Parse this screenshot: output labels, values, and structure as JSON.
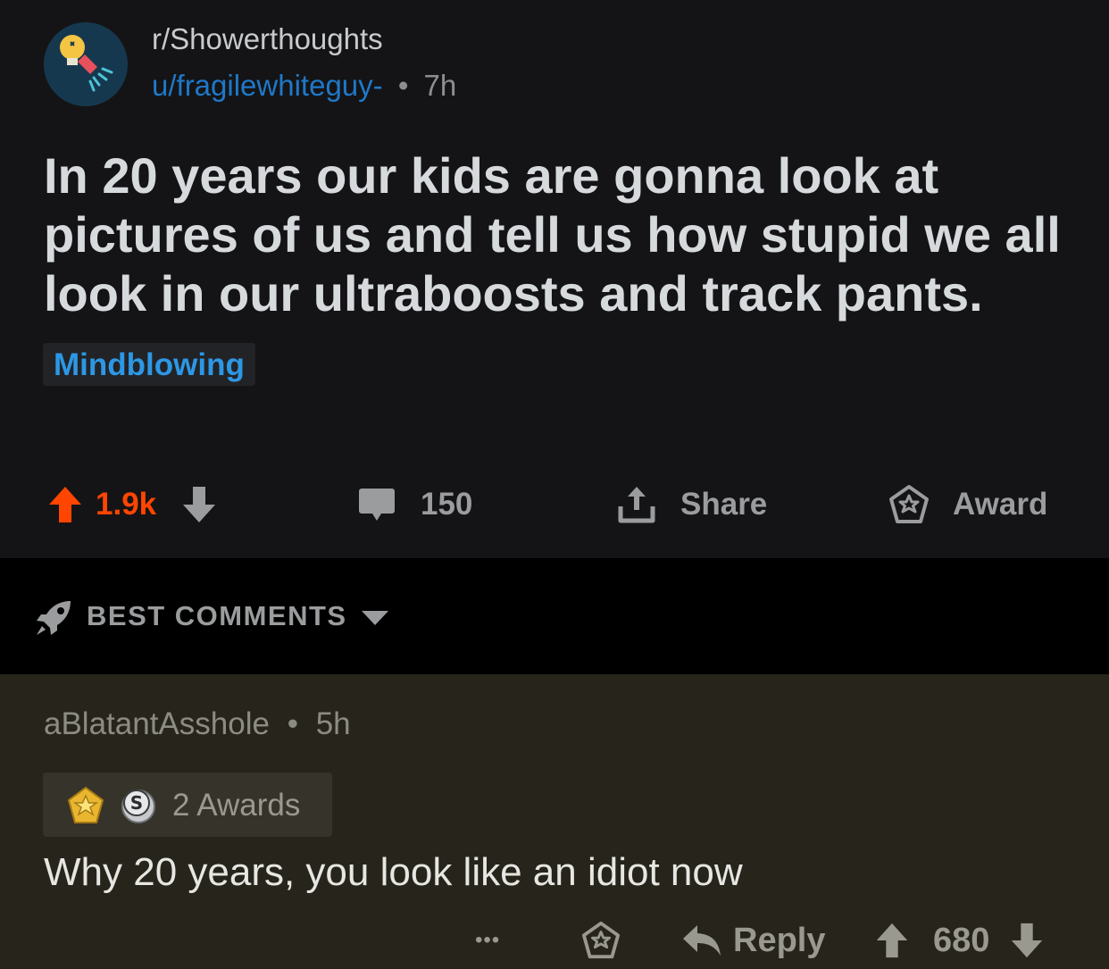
{
  "post": {
    "subreddit": "r/Showerthoughts",
    "author": "u/fragilewhiteguy-",
    "separator": "•",
    "age": "7h",
    "title": "In 20 years our kids are gonna look at pictures of us and tell us how stupid we all look in our ultraboosts and track pants.",
    "flair": "Mindblowing",
    "votes": "1.9k",
    "comments": "150",
    "share_label": "Share",
    "award_label": "Award",
    "upvote_color": "#ff4500"
  },
  "sort": {
    "label": "BEST COMMENTS"
  },
  "comment": {
    "author": "aBlatantAsshole",
    "separator": "•",
    "age": "5h",
    "awards_label": "2 Awards",
    "body": "Why 20 years, you look like an idiot now",
    "more_label": "•••",
    "reply_label": "Reply",
    "score": "680"
  },
  "icons": {
    "subreddit_avatar": "lightbulb-shower-icon",
    "upvote": "arrow-up-icon",
    "downvote": "arrow-down-icon",
    "comment": "speech-bubble-icon",
    "share": "share-upload-icon",
    "award": "star-award-icon",
    "sort": "rocket-icon",
    "dropdown": "caret-down-icon",
    "reply": "reply-arrow-icon"
  }
}
